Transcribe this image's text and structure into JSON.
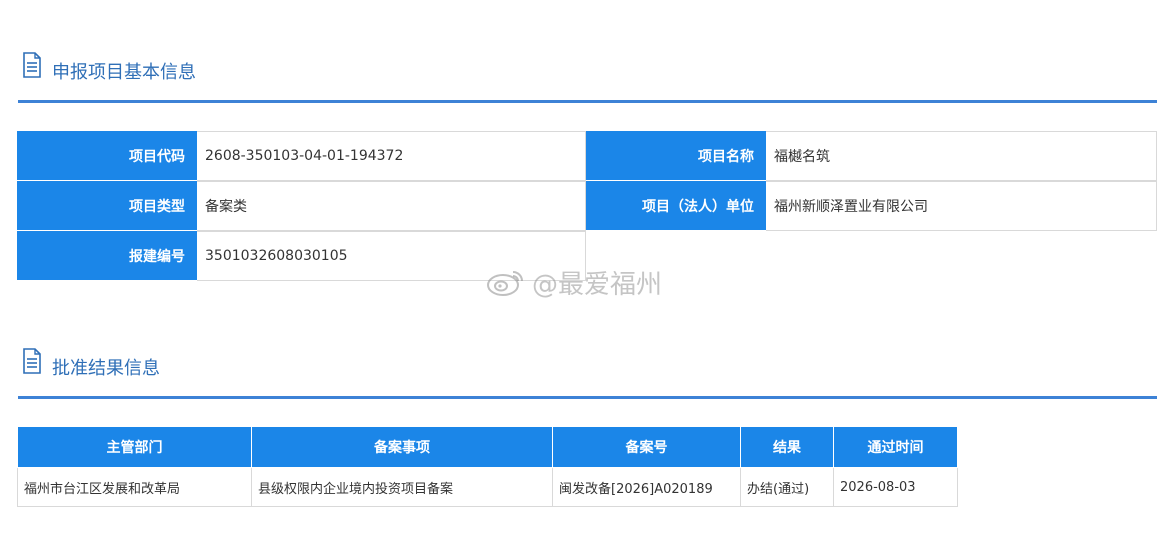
{
  "sections": {
    "basic_info_title": "申报项目基本信息",
    "approval_title": "批准结果信息"
  },
  "basic_info": {
    "project_code_label": "项目代码",
    "project_code": "2608-350103-04-01-194372",
    "project_name_label": "项目名称",
    "project_name": "福樾名筑",
    "project_type_label": "项目类型",
    "project_type": "备案类",
    "legal_unit_label": "项目（法人）单位",
    "legal_unit": "福州新顺泽置业有限公司",
    "build_no_label": "报建编号",
    "build_no": "3501032608030105"
  },
  "approval": {
    "columns": [
      "主管部门",
      "备案事项",
      "备案号",
      "结果",
      "通过时间"
    ],
    "rows": [
      {
        "dept": "福州市台江区发展和改革局",
        "item": "县级权限内企业境内投资项目备案",
        "record_no": "闽发改备[2026]A020189",
        "result": "办结(通过)",
        "date": "2026-08-03"
      }
    ]
  },
  "watermark": {
    "text": "@最爱福州",
    "icon": "weibo-icon"
  },
  "colors": {
    "header_blue": "#1b86e8",
    "section_line": "#3d82d6",
    "section_title": "#2f6fb7"
  }
}
